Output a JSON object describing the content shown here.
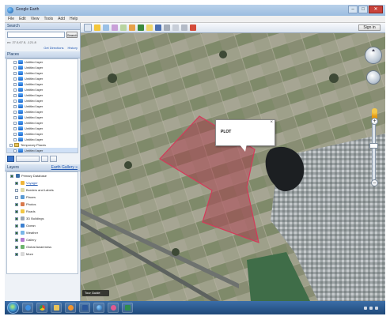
{
  "window": {
    "title": "Google Earth"
  },
  "menu": [
    "File",
    "Edit",
    "View",
    "Tools",
    "Add",
    "Help"
  ],
  "toolbar": {
    "signin_label": "Sign in"
  },
  "search": {
    "panel_title": "Search",
    "input_placeholder": "",
    "button_label": "Search",
    "coords_text": "ex: 27.0,67.5, -121.8",
    "links": [
      "Get Directions",
      "History"
    ]
  },
  "places": {
    "panel_title": "Places",
    "items": [
      "Untitled layer",
      "Untitled layer",
      "Untitled layer",
      "Untitled layer",
      "Untitled layer",
      "Untitled layer",
      "Untitled layer",
      "Untitled layer",
      "Untitled layer",
      "Untitled layer",
      "Untitled layer",
      "Untitled layer",
      "Untitled layer",
      "Untitled layer",
      "Untitled layer"
    ],
    "temporary": "Temporary Places",
    "temp_child": "Untitled layer"
  },
  "layers": {
    "panel_title": "Layers",
    "gallery_link": "Earth Gallery »",
    "root": "Primary Database",
    "items": [
      "Voyager",
      "Borders and Labels",
      "Places",
      "Photos",
      "Roads",
      "3D Buildings",
      "Ocean",
      "Weather",
      "Gallery",
      "Global Awareness",
      "More"
    ],
    "colors": [
      "#f0b63a",
      "#e0d9a4",
      "#5a9bd4",
      "#d9794c",
      "#f2c744",
      "#9aa6b4",
      "#3a7fd0",
      "#79b6e8",
      "#b37bd0",
      "#6cb36c",
      "#d9d9d9"
    ]
  },
  "balloon": {
    "title": "PLOT"
  },
  "polygon": {
    "label": ""
  },
  "map": {
    "tour_guide": "Tour Guide",
    "status": ""
  },
  "taskbar": {
    "apps": [
      "Internet Explorer",
      "Chrome",
      "Explorer",
      "Media Player",
      "Word",
      "Google Earth",
      "Paint",
      "Excel"
    ],
    "clock_time": "",
    "clock_date": ""
  }
}
